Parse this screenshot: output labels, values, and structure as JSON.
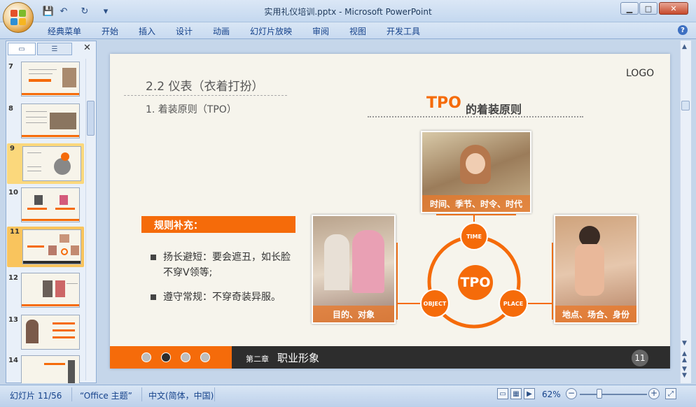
{
  "window": {
    "title": "实用礼仪培训.pptx - Microsoft PowerPoint",
    "minimize": "▁",
    "maximize": "□",
    "close": "✕"
  },
  "qat": {
    "save": "💾",
    "undo": "↶",
    "redo": "↻",
    "more": "▾"
  },
  "menu": [
    "经典菜单",
    "开始",
    "插入",
    "设计",
    "动画",
    "幻灯片放映",
    "审阅",
    "视图",
    "开发工具"
  ],
  "help": "?",
  "pane": {
    "close": "✕"
  },
  "thumbs": [
    "7",
    "8",
    "9",
    "10",
    "11",
    "12",
    "13",
    "14"
  ],
  "slide": {
    "section": "2.2  仪表（衣着打扮）",
    "subsection": "1. 着装原则（TPO）",
    "logo": "LOGO",
    "heading_tpo": "TPO",
    "heading_rest": "的着装原则",
    "rule_box": "规则补充：",
    "bullets": [
      "扬长避短：要会遮丑，如长脸不穿V领等;",
      "遵守常规：不穿奇装异服。"
    ],
    "center": "TPO",
    "node_time": "TIME",
    "node_object": "OBJECT",
    "node_place": "PLACE",
    "cap_top": "时间、季节、时令、时代",
    "cap_left": "目的、对象",
    "cap_right": "地点、场合、身份",
    "footer_chapter": "第二章",
    "footer_title": "职业形象",
    "page_num": "11"
  },
  "status": {
    "slide_info": "幻灯片 11/56",
    "theme": "“Office 主题”",
    "language": "中文(简体，中国)",
    "zoom": "62%",
    "zoom_level": 0.62
  },
  "colors": {
    "accent": "#f56b0a",
    "dark": "#2d2d2d"
  }
}
